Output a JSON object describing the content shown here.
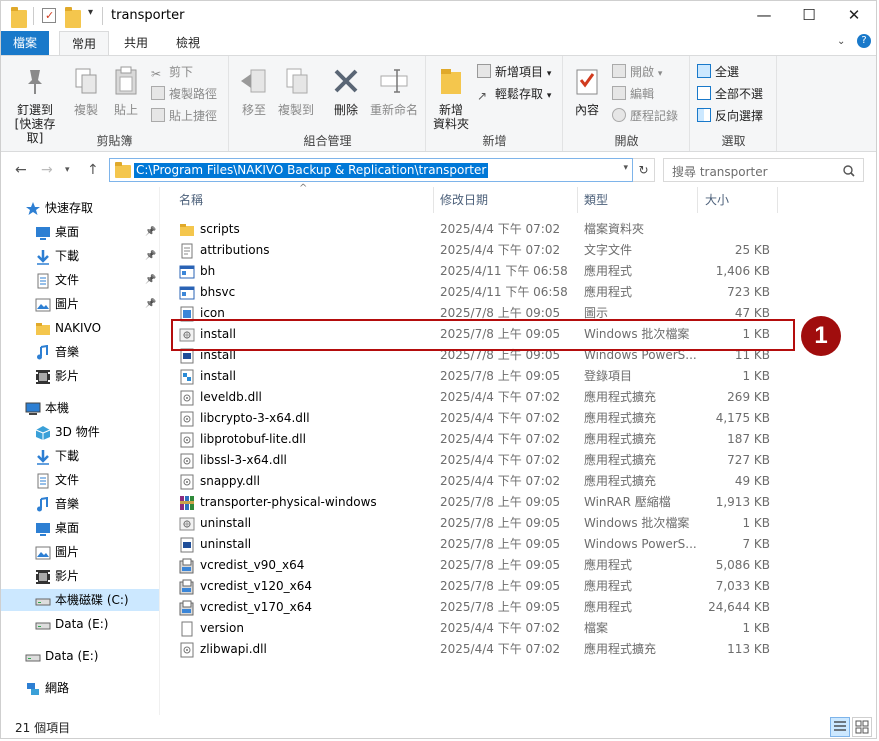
{
  "window": {
    "title": "transporter"
  },
  "ribbon_tabs": [
    "檔案",
    "常用",
    "共用",
    "檢視"
  ],
  "ribbon": {
    "clipboard": {
      "title": "剪貼簿",
      "pin": "釘選到 [快速存取]",
      "copy": "複製",
      "paste": "貼上",
      "cut": "剪下",
      "copy_path": "複製路徑",
      "paste_shortcut": "貼上捷徑"
    },
    "organize": {
      "title": "組合管理",
      "move_to": "移至",
      "copy_to": "複製到",
      "delete": "刪除",
      "rename": "重新命名"
    },
    "new": {
      "title": "新增",
      "new_folder": "新增\n資料夾",
      "new_item": "新增項目",
      "easy_access": "輕鬆存取"
    },
    "open": {
      "title": "開啟",
      "properties": "內容",
      "open": "開啟",
      "edit": "編輯",
      "history": "歷程記錄"
    },
    "select": {
      "title": "選取",
      "select_all": "全選",
      "select_none": "全部不選",
      "invert": "反向選擇"
    }
  },
  "address": {
    "path": "C:\\Program Files\\NAKIVO Backup & Replication\\transporter"
  },
  "search": {
    "placeholder": "搜尋 transporter"
  },
  "nav": [
    {
      "label": "快速存取",
      "icon": "star-icon"
    },
    {
      "label": "桌面",
      "icon": "desktop-icon",
      "pinned": true
    },
    {
      "label": "下載",
      "icon": "download-icon",
      "pinned": true
    },
    {
      "label": "文件",
      "icon": "document-icon",
      "pinned": true
    },
    {
      "label": "圖片",
      "icon": "picture-icon",
      "pinned": true
    },
    {
      "label": "NAKIVO",
      "icon": "folder-icon"
    },
    {
      "label": "音樂",
      "icon": "music-icon"
    },
    {
      "label": "影片",
      "icon": "video-icon"
    },
    {
      "label": "本機",
      "icon": "computer-icon"
    },
    {
      "label": "3D 物件",
      "icon": "cube-icon"
    },
    {
      "label": "下載",
      "icon": "download-icon"
    },
    {
      "label": "文件",
      "icon": "document-icon"
    },
    {
      "label": "音樂",
      "icon": "music-icon"
    },
    {
      "label": "桌面",
      "icon": "desktop-icon"
    },
    {
      "label": "圖片",
      "icon": "picture-icon"
    },
    {
      "label": "影片",
      "icon": "video-icon"
    },
    {
      "label": "本機磁碟 (C:)",
      "icon": "drive-icon"
    },
    {
      "label": "Data (E:)",
      "icon": "drive-icon"
    },
    {
      "label": "Data (E:)",
      "icon": "drive-icon"
    },
    {
      "label": "網路",
      "icon": "network-icon"
    }
  ],
  "columns": [
    "名稱",
    "修改日期",
    "類型",
    "大小"
  ],
  "files": [
    {
      "name": "scripts",
      "date": "2025/4/4 下午 07:02",
      "type": "檔案資料夾",
      "size": "",
      "icon": "folder-icon"
    },
    {
      "name": "attributions",
      "date": "2025/4/4 下午 07:02",
      "type": "文字文件",
      "size": "25 KB",
      "icon": "text-file-icon"
    },
    {
      "name": "bh",
      "date": "2025/4/11 下午 06:58",
      "type": "應用程式",
      "size": "1,406 KB",
      "icon": "app-icon"
    },
    {
      "name": "bhsvc",
      "date": "2025/4/11 下午 06:58",
      "type": "應用程式",
      "size": "723 KB",
      "icon": "app-icon"
    },
    {
      "name": "icon",
      "date": "2025/7/8 上午 09:05",
      "type": "圖示",
      "size": "47 KB",
      "icon": "icon-file-icon"
    },
    {
      "name": "install",
      "date": "2025/7/8 上午 09:05",
      "type": "Windows 批次檔案",
      "size": "1 KB",
      "icon": "batch-file-icon"
    },
    {
      "name": "install",
      "date": "2025/7/8 上午 09:05",
      "type": "Windows PowerS...",
      "size": "11 KB",
      "icon": "powershell-file-icon"
    },
    {
      "name": "install",
      "date": "2025/7/8 上午 09:05",
      "type": "登錄項目",
      "size": "1 KB",
      "icon": "registry-file-icon"
    },
    {
      "name": "leveldb.dll",
      "date": "2025/4/4 下午 07:02",
      "type": "應用程式擴充",
      "size": "269 KB",
      "icon": "dll-file-icon"
    },
    {
      "name": "libcrypto-3-x64.dll",
      "date": "2025/4/4 下午 07:02",
      "type": "應用程式擴充",
      "size": "4,175 KB",
      "icon": "dll-file-icon"
    },
    {
      "name": "libprotobuf-lite.dll",
      "date": "2025/4/4 下午 07:02",
      "type": "應用程式擴充",
      "size": "187 KB",
      "icon": "dll-file-icon"
    },
    {
      "name": "libssl-3-x64.dll",
      "date": "2025/4/4 下午 07:02",
      "type": "應用程式擴充",
      "size": "727 KB",
      "icon": "dll-file-icon"
    },
    {
      "name": "snappy.dll",
      "date": "2025/4/4 下午 07:02",
      "type": "應用程式擴充",
      "size": "49 KB",
      "icon": "dll-file-icon"
    },
    {
      "name": "transporter-physical-windows",
      "date": "2025/7/8 上午 09:05",
      "type": "WinRAR 壓縮檔",
      "size": "1,913 KB",
      "icon": "archive-icon"
    },
    {
      "name": "uninstall",
      "date": "2025/7/8 上午 09:05",
      "type": "Windows 批次檔案",
      "size": "1 KB",
      "icon": "batch-file-icon"
    },
    {
      "name": "uninstall",
      "date": "2025/7/8 上午 09:05",
      "type": "Windows PowerS...",
      "size": "7 KB",
      "icon": "powershell-file-icon"
    },
    {
      "name": "vcredist_v90_x64",
      "date": "2025/7/8 上午 09:05",
      "type": "應用程式",
      "size": "5,086 KB",
      "icon": "installer-icon"
    },
    {
      "name": "vcredist_v120_x64",
      "date": "2025/7/8 上午 09:05",
      "type": "應用程式",
      "size": "7,033 KB",
      "icon": "installer-icon"
    },
    {
      "name": "vcredist_v170_x64",
      "date": "2025/7/8 上午 09:05",
      "type": "應用程式",
      "size": "24,644 KB",
      "icon": "installer-icon"
    },
    {
      "name": "version",
      "date": "2025/4/4 下午 07:02",
      "type": "檔案",
      "size": "1 KB",
      "icon": "blank-file-icon"
    },
    {
      "name": "zlibwapi.dll",
      "date": "2025/4/4 下午 07:02",
      "type": "應用程式擴充",
      "size": "113 KB",
      "icon": "dll-file-icon"
    }
  ],
  "annotation": {
    "badge": "1"
  },
  "status": {
    "count": "21 個項目"
  },
  "colors": {
    "accent": "#1979ca",
    "selection": "#0078d7",
    "annotation": "#b40d0d"
  }
}
